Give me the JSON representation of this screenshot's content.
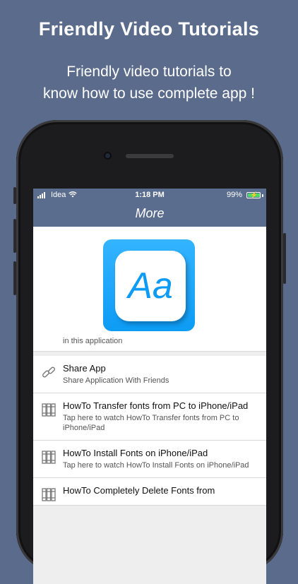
{
  "promo": {
    "headline": "Friendly Video Tutorials",
    "subline_1": "Friendly video tutorials to",
    "subline_2": "know how to use complete app !"
  },
  "status_bar": {
    "carrier": "Idea",
    "time": "1:18 PM",
    "battery_percent": "99%",
    "battery_level": 0.99,
    "charging": true
  },
  "nav": {
    "title": "More"
  },
  "app_icon": {
    "glyph": "Aa",
    "color": "#1aa7fb"
  },
  "caption": "in this application",
  "items": [
    {
      "icon": "link-icon",
      "title": "Share App",
      "subtitle": "Share Application With Friends"
    },
    {
      "icon": "books-icon",
      "title": "HowTo Transfer fonts from PC to iPhone/iPad",
      "subtitle": "Tap here to watch HowTo Transfer fonts from PC to iPhone/iPad"
    },
    {
      "icon": "books-icon",
      "title": "HowTo Install Fonts on iPhone/iPad",
      "subtitle": "Tap here to watch HowTo Install Fonts on iPhone/iPad"
    },
    {
      "icon": "books-icon",
      "title": "HowTo Completely Delete Fonts from",
      "subtitle": ""
    }
  ],
  "colors": {
    "background": "#5a6b8c",
    "nav_bar": "#5b6d8e",
    "accent": "#0d9bf5"
  }
}
